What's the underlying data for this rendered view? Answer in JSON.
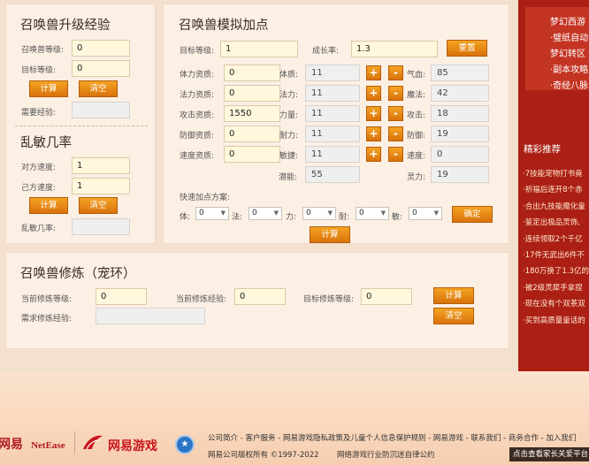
{
  "upgrade": {
    "title": "召唤兽升级经验",
    "current_level_label": "召唤兽等级:",
    "current_level_value": "0",
    "target_level_label": "目标等级:",
    "target_level_value": "0",
    "calc_label": "计算",
    "clear_label": "清空",
    "need_exp_label": "需要经验:",
    "need_exp_value": ""
  },
  "dodge": {
    "title": "乱敏几率",
    "opponent_speed_label": "对方速度:",
    "opponent_speed_value": "1",
    "self_speed_label": "己方速度:",
    "self_speed_value": "1",
    "calc_label": "计算",
    "clear_label": "清空",
    "rate_label": "乱敏几率:",
    "rate_value": ""
  },
  "sim": {
    "title": "召唤兽模拟加点",
    "target_level_label": "目标等级:",
    "target_level_value": "1",
    "growth_label": "成长率:",
    "growth_value": "1.3",
    "reset_label": "重置",
    "rows": [
      {
        "label": "体力资质:",
        "value": "0",
        "stat": "体质:",
        "stat_value": "11",
        "result": "气血:",
        "result_value": "85"
      },
      {
        "label": "法力资质:",
        "value": "0",
        "stat": "法力:",
        "stat_value": "11",
        "result": "魔法:",
        "result_value": "42"
      },
      {
        "label": "攻击资质:",
        "value": "1550",
        "stat": "力量:",
        "stat_value": "11",
        "result": "攻击:",
        "result_value": "18"
      },
      {
        "label": "防御资质:",
        "value": "0",
        "stat": "耐力:",
        "stat_value": "11",
        "result": "防御:",
        "result_value": "19"
      },
      {
        "label": "速度资质:",
        "value": "0",
        "stat": "敏捷:",
        "stat_value": "11",
        "result": "速度:",
        "result_value": "0"
      }
    ],
    "plus_label": "+",
    "minus_label": "-",
    "potential_label": "潜能:",
    "potential_value": "55",
    "spirit_label": "灵力:",
    "spirit_value": "19",
    "quick_title": "快速加点方案:",
    "quick": [
      {
        "label": "体:",
        "value": "0"
      },
      {
        "label": "法:",
        "value": "0"
      },
      {
        "label": "力:",
        "value": "0"
      },
      {
        "label": "耐:",
        "value": "0"
      },
      {
        "label": "敏:",
        "value": "0"
      }
    ],
    "confirm_label": "确定",
    "calc_label": "计算"
  },
  "cultivate": {
    "title": "召唤兽修炼（宠环）",
    "current_label": "当前修炼等级:",
    "current_value": "0",
    "current_exp_label": "当前修炼经验:",
    "current_exp_value": "0",
    "target_label": "目标修炼等级:",
    "target_value": "0",
    "calc_label": "计算",
    "need_exp_label": "需求修炼经验:",
    "need_exp_value": "",
    "clear_label": "清空"
  },
  "sidebar": {
    "links": [
      "梦幻西游",
      "·璧纸自动",
      "梦幻转区",
      "·副本攻略",
      "·奇经八脉"
    ],
    "recommend_title": "精彩推荐",
    "news": [
      "·7技能宠物打书竟",
      "·祈福后连开8个赤",
      "·合出九技能魔化童",
      "·鉴定出极品灵饰,",
      "·连续领取2个千亿",
      "·17件无武出6件不",
      "·180万换了1.3亿的",
      "·被2级灵犀手拿捏",
      "·现在没有个双茶双",
      "·买到高质量童话的"
    ]
  },
  "footer": {
    "netease_cn": "网易",
    "netease_en": "NetEase",
    "games_logo": "网易游戏",
    "links": "公司简介 - 客户服务 - 网易游戏隐私政策及儿童个人信息保护规则 - 网易游戏 - 联系我们 - 商务合作 - 加入我们",
    "copyright": "网易公司版权所有 ©1997-2022",
    "pledge": "网络游戏行业防沉迷自律公约",
    "parent": "点击查看家长关爱平台"
  },
  "colors": {
    "accent": "#e2820f",
    "sidebar": "#ab1f14",
    "panel": "#fcefe4"
  }
}
